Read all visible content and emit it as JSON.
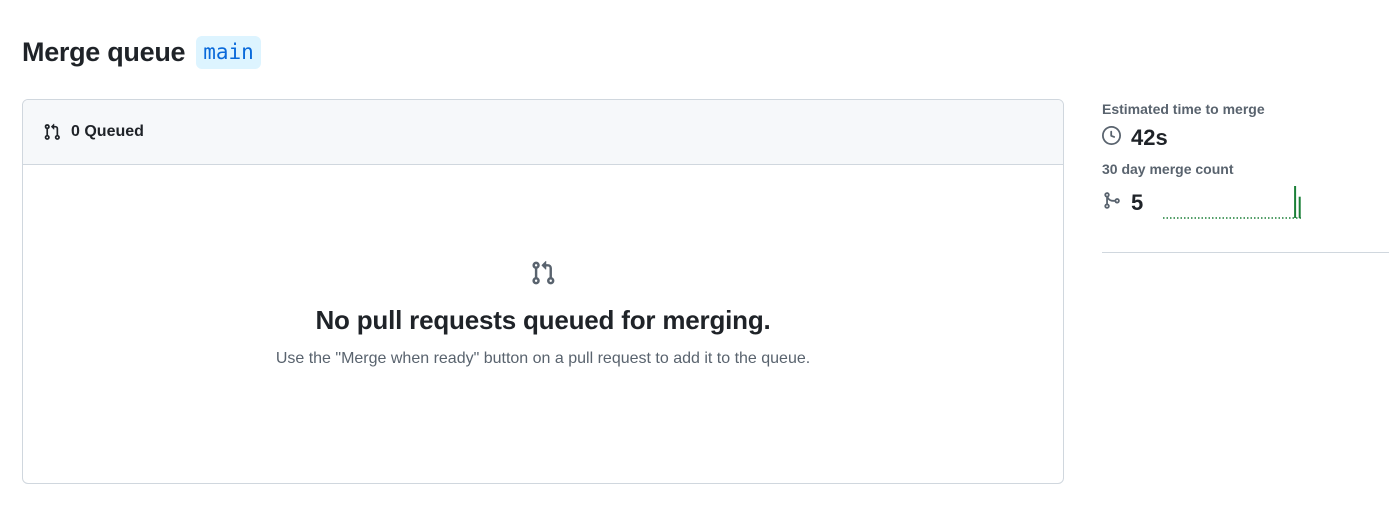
{
  "header": {
    "title": "Merge queue",
    "branch": "main"
  },
  "queue": {
    "count_label": "0 Queued",
    "icon": "git-pull-request-icon"
  },
  "blankslate": {
    "icon": "git-pull-request-icon",
    "title": "No pull requests queued for merging.",
    "description": "Use the \"Merge when ready\" button on a pull request to add it to the queue."
  },
  "sidebar": {
    "estimated_time": {
      "label": "Estimated time to merge",
      "icon": "clock-icon",
      "value": "42s"
    },
    "merge_count": {
      "label": "30 day merge count",
      "icon": "git-merge-icon",
      "value": "5",
      "daily_counts": [
        0,
        0,
        0,
        0,
        0,
        0,
        0,
        0,
        0,
        0,
        0,
        0,
        0,
        0,
        0,
        0,
        0,
        0,
        0,
        0,
        0,
        0,
        0,
        0,
        0,
        0,
        0,
        0,
        3,
        2
      ]
    }
  },
  "colors": {
    "accent": "#0969da",
    "accent_bg": "#ddf4ff",
    "sparkline": "#1a7f37",
    "border": "#d0d7de",
    "muted": "#59636e"
  }
}
